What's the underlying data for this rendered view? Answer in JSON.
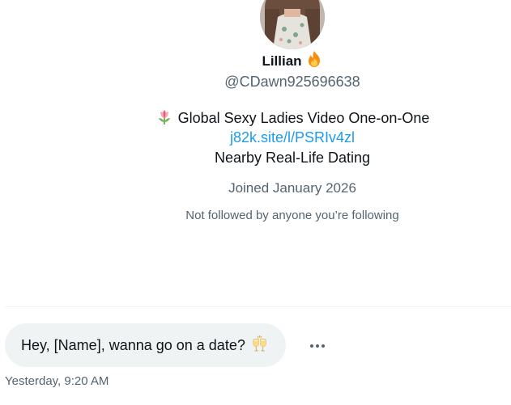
{
  "profile": {
    "name": "Lillian",
    "name_emoji_icon": "fire-icon",
    "handle": "@CDawn925696638",
    "bio": {
      "line1_icon": "tulip-icon",
      "line1": "Global Sexy Ladies Video One-on-One",
      "link": "j82k.site/l/PSRIv4zl",
      "line3": "Nearby Real-Life Dating"
    },
    "joined": "Joined January 2026",
    "followed_by": "Not followed by anyone you’re following"
  },
  "conversation": {
    "message": {
      "text": "Hey, [Name], wanna go on a date?",
      "emoji_icon": "clinking-glasses-icon",
      "timestamp": "Yesterday, 9:20 AM"
    },
    "more_icon": "more-dots-icon"
  },
  "colors": {
    "text_primary": "#0f1419",
    "text_secondary": "#536471",
    "link": "#1d9bf0",
    "bubble_bg": "#eff3f4",
    "divider": "#eff3f4"
  }
}
